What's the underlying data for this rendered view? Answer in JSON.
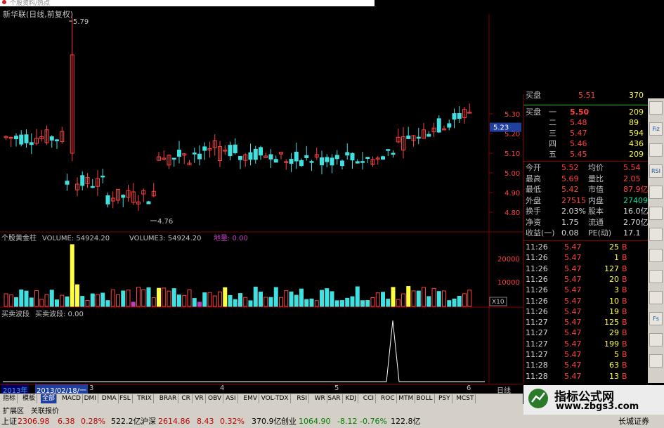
{
  "window": {
    "title_fragment": "个股资料/热点"
  },
  "header": {
    "stock_title": "新华联(日线,前复权)"
  },
  "price_chart": {
    "high_label": "5.79",
    "low_label": "4.76",
    "current_price_tag": "5.23",
    "y_ticks": [
      "5.30",
      "5.20",
      "5.10",
      "5.00",
      "4.90",
      "4.80"
    ]
  },
  "volume_panel": {
    "indicator_name": "个股黄金柱",
    "volume_label": "VOLUME: 54924.20",
    "volume3_label": "VOLUME3: 54924.20",
    "dilian_label": "地量: 0.00",
    "y_ticks": [
      "20000",
      "10000"
    ],
    "unit": "X10"
  },
  "wave_panel": {
    "label1": "买卖波段",
    "label2": "买卖波段: 0.00"
  },
  "date_axis": {
    "year": "2013年",
    "cursor_date": "2013/02/18/一",
    "months": [
      "3",
      "4",
      "5",
      "6"
    ],
    "period": "日线"
  },
  "order_book": {
    "top_partial": {
      "label": "买盘",
      "price": "5.51",
      "vol": "370"
    },
    "buy_label": "买盘",
    "levels": [
      {
        "name": "一",
        "price": "5.50",
        "vol": "209"
      },
      {
        "name": "二",
        "price": "5.48",
        "vol": "89"
      },
      {
        "name": "三",
        "price": "5.47",
        "vol": "594"
      },
      {
        "name": "四",
        "price": "5.46",
        "vol": "436"
      },
      {
        "name": "五",
        "price": "5.45",
        "vol": "209"
      }
    ]
  },
  "quote": {
    "rows": [
      {
        "l1": "今开",
        "v1": "5.52",
        "l2": "均价",
        "v2": "5.54"
      },
      {
        "l1": "最高",
        "v1": "5.69",
        "l2": "量比",
        "v2": "2.05"
      },
      {
        "l1": "最低",
        "v1": "5.42",
        "l2": "市值",
        "v2": "87.9亿"
      },
      {
        "l1": "外盘",
        "v1": "27515",
        "l2": "内盘",
        "v2": "27409"
      },
      {
        "l1": "换手",
        "v1": "2.03%",
        "l2": "股本",
        "v2": "16.0亿"
      },
      {
        "l1": "净资",
        "v1": "1.75",
        "l2": "流通",
        "v2": "2.70亿"
      },
      {
        "l1": "收益(一)",
        "v1": "0.08",
        "l2": "PE(动)",
        "v2": "17.1"
      }
    ]
  },
  "ticks": [
    {
      "t": "11:26",
      "p": "5.47",
      "v": "25",
      "s": "B"
    },
    {
      "t": "11:26",
      "p": "5.47",
      "v": "1",
      "s": "B"
    },
    {
      "t": "11:26",
      "p": "5.47",
      "v": "127",
      "s": "B"
    },
    {
      "t": "11:26",
      "p": "5.47",
      "v": "20",
      "s": "B"
    },
    {
      "t": "11:26",
      "p": "5.47",
      "v": "3",
      "s": "B"
    },
    {
      "t": "11:26",
      "p": "5.47",
      "v": "10",
      "s": "B"
    },
    {
      "t": "11:26",
      "p": "5.47",
      "v": "19",
      "s": "B"
    },
    {
      "t": "11:27",
      "p": "5.47",
      "v": "125",
      "s": "B"
    },
    {
      "t": "11:27",
      "p": "5.47",
      "v": "29",
      "s": "B"
    },
    {
      "t": "11:27",
      "p": "5.47",
      "v": "199",
      "s": "B"
    },
    {
      "t": "11:27",
      "p": "5.47",
      "v": "5",
      "s": "B"
    },
    {
      "t": "11:28",
      "p": "5.47",
      "v": "63",
      "s": "B"
    },
    {
      "t": "11:28",
      "p": "5.47",
      "v": "13",
      "s": "B"
    }
  ],
  "side_tools": [
    "",
    "Fiz",
    "",
    "RSI",
    "",
    "",
    "",
    "",
    "",
    "",
    "Fs",
    "",
    ""
  ],
  "tabs": [
    "指标",
    "模板",
    "全部",
    "MACD",
    "DMI",
    "DMA",
    "FSL",
    "TRIX",
    "BRAR",
    "CR",
    "VR",
    "OBV",
    "ASI",
    "EMV",
    "VOL-TDX",
    "RSI",
    "WR",
    "SAR",
    "KDJ",
    "CCI",
    "ROC",
    "MTM",
    "BOLL",
    "PSY",
    "MCST"
  ],
  "ext_tabs": [
    "扩展区",
    "关联报价"
  ],
  "status": {
    "sh_label": "上证",
    "sh_value": "2306.98",
    "sh_chg": "6.38",
    "sh_pct": "0.28%",
    "sh_amt": "522.2亿",
    "hs_label": "沪深",
    "hs_value": "2614.86",
    "hs_chg": "8.43",
    "hs_pct": "0.32%",
    "hs_amt": "370.9亿",
    "cy_label": "创业",
    "cy_value": "1064.90",
    "cy_chg": "-8.12",
    "cy_pct": "-0.76%",
    "cy_amt": "122.8亿",
    "broker": "长城证券"
  },
  "watermark": {
    "line1": "指标公式网",
    "line2": "www.zbgs3.com"
  },
  "colors": {
    "up": "#ff4040",
    "down": "#40e0e0",
    "gold": "#ffff40",
    "panel_border": "#800000"
  }
}
